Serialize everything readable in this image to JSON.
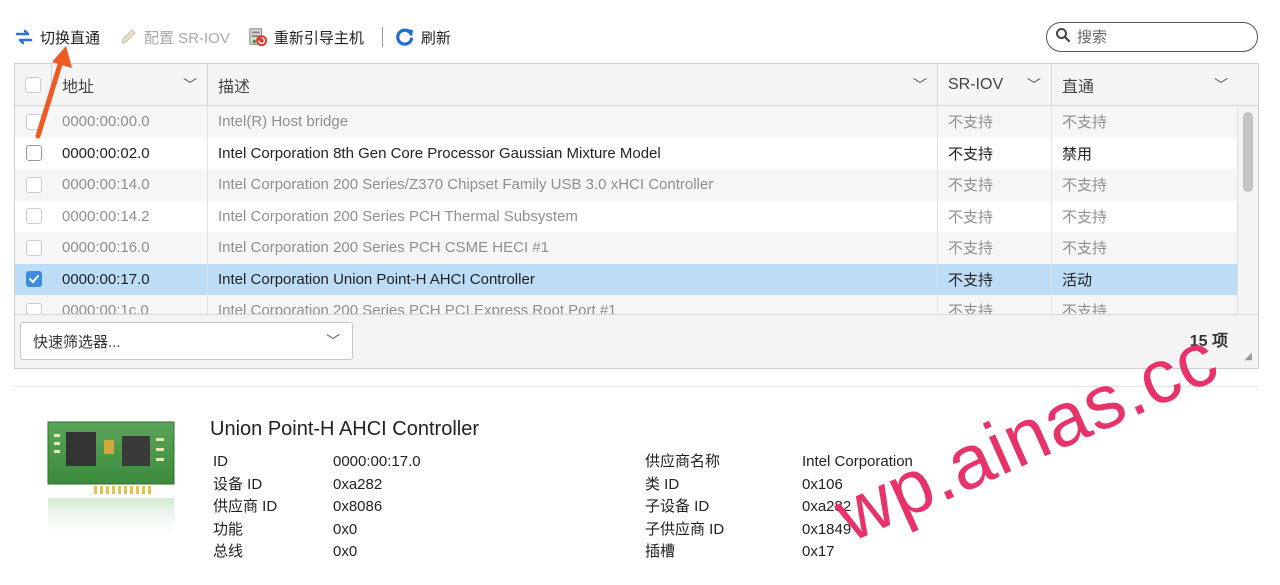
{
  "toolbar": {
    "passthrough": "切换直通",
    "sriov": "配置 SR-IOV",
    "reboot": "重新引导主机",
    "refresh": "刷新",
    "search_placeholder": "搜索"
  },
  "grid": {
    "columns": {
      "address": "地址",
      "description": "描述",
      "sriov": "SR-IOV",
      "passthrough": "直通"
    },
    "rows": [
      {
        "address": "0000:00:00.0",
        "description": "Intel(R) Host bridge",
        "sriov": "不支持",
        "passthrough": "不支持",
        "checked": false,
        "dim": true
      },
      {
        "address": "0000:00:02.0",
        "description": "Intel Corporation 8th Gen Core Processor Gaussian Mixture Model",
        "sriov": "不支持",
        "passthrough": "禁用",
        "checked": false,
        "dim": false
      },
      {
        "address": "0000:00:14.0",
        "description": "Intel Corporation 200 Series/Z370 Chipset Family USB 3.0 xHCI Controller",
        "sriov": "不支持",
        "passthrough": "不支持",
        "checked": false,
        "dim": true
      },
      {
        "address": "0000:00:14.2",
        "description": "Intel Corporation 200 Series PCH Thermal Subsystem",
        "sriov": "不支持",
        "passthrough": "不支持",
        "checked": false,
        "dim": true
      },
      {
        "address": "0000:00:16.0",
        "description": "Intel Corporation 200 Series PCH CSME HECI #1",
        "sriov": "不支持",
        "passthrough": "不支持",
        "checked": false,
        "dim": true
      },
      {
        "address": "0000:00:17.0",
        "description": "Intel Corporation Union Point-H AHCI Controller",
        "sriov": "不支持",
        "passthrough": "活动",
        "checked": true,
        "dim": false
      },
      {
        "address": "0000:00:1c.0",
        "description": "Intel Corporation 200 Series PCH PCI Express Root Port #1",
        "sriov": "不支持",
        "passthrough": "不支持",
        "checked": false,
        "dim": true
      }
    ],
    "filter_label": "快速筛选器...",
    "count": "15 项"
  },
  "details": {
    "title": "Union Point-H AHCI Controller",
    "left": [
      {
        "key": "ID",
        "value": "0000:00:17.0"
      },
      {
        "key": "设备 ID",
        "value": "0xa282"
      },
      {
        "key": "供应商 ID",
        "value": "0x8086"
      },
      {
        "key": "功能",
        "value": "0x0"
      },
      {
        "key": "总线",
        "value": "0x0"
      }
    ],
    "right": [
      {
        "key": "供应商名称",
        "value": "Intel Corporation"
      },
      {
        "key": "类 ID",
        "value": "0x106"
      },
      {
        "key": "子设备 ID",
        "value": "0xa282"
      },
      {
        "key": "子供应商 ID",
        "value": "0x1849"
      },
      {
        "key": "插槽",
        "value": "0x17"
      }
    ]
  },
  "annotations": {
    "watermark": "wp.ainas.cc",
    "watermark_color": "#e8326a",
    "arrow_color": "#ee5a24"
  },
  "colors": {
    "selected_row": "#bddcf5",
    "checkbox_on": "#3b8be0",
    "refresh_icon": "#1e6fd1"
  }
}
